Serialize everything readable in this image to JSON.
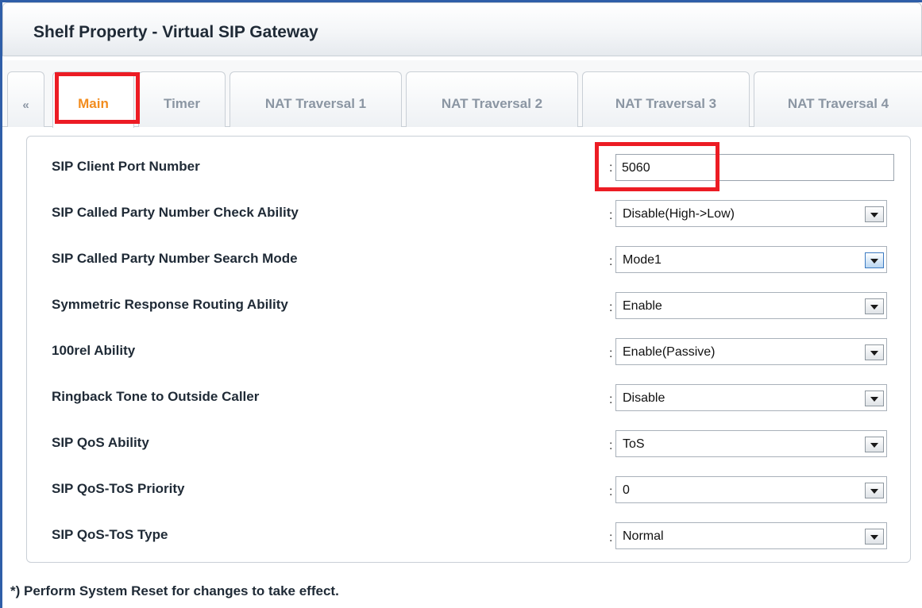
{
  "window": {
    "title": "Shelf Property - Virtual SIP Gateway"
  },
  "tabs": {
    "prev": "«",
    "items": [
      "Main",
      "Timer",
      "NAT Traversal 1",
      "NAT Traversal 2",
      "NAT Traversal 3",
      "NAT Traversal 4"
    ],
    "active": "Main"
  },
  "form": {
    "separator": ":",
    "rows": [
      {
        "label": "SIP Client Port Number",
        "value": "5060",
        "type": "text"
      },
      {
        "label": "SIP Called Party Number Check Ability",
        "value": "Disable(High->Low)",
        "type": "select"
      },
      {
        "label": "SIP Called Party Number Search Mode",
        "value": "Mode1",
        "type": "select"
      },
      {
        "label": "Symmetric Response Routing Ability",
        "value": "Enable",
        "type": "select"
      },
      {
        "label": "100rel Ability",
        "value": "Enable(Passive)",
        "type": "select"
      },
      {
        "label": "Ringback Tone to Outside Caller",
        "value": "Disable",
        "type": "select"
      },
      {
        "label": "SIP QoS Ability",
        "value": "ToS",
        "type": "select"
      },
      {
        "label": "SIP QoS-ToS Priority",
        "value": "0",
        "type": "select"
      },
      {
        "label": "SIP QoS-ToS Type",
        "value": "Normal",
        "type": "select"
      }
    ]
  },
  "footer": {
    "note": "*) Perform System Reset for changes to take effect."
  },
  "colors": {
    "highlight": "#ec1c24",
    "active_tab_text": "#f28c1e",
    "frame": "#2f5ea8"
  },
  "icons": {
    "dropdown": "chevron-down-icon",
    "tab_prev": "double-left-arrow-icon"
  }
}
